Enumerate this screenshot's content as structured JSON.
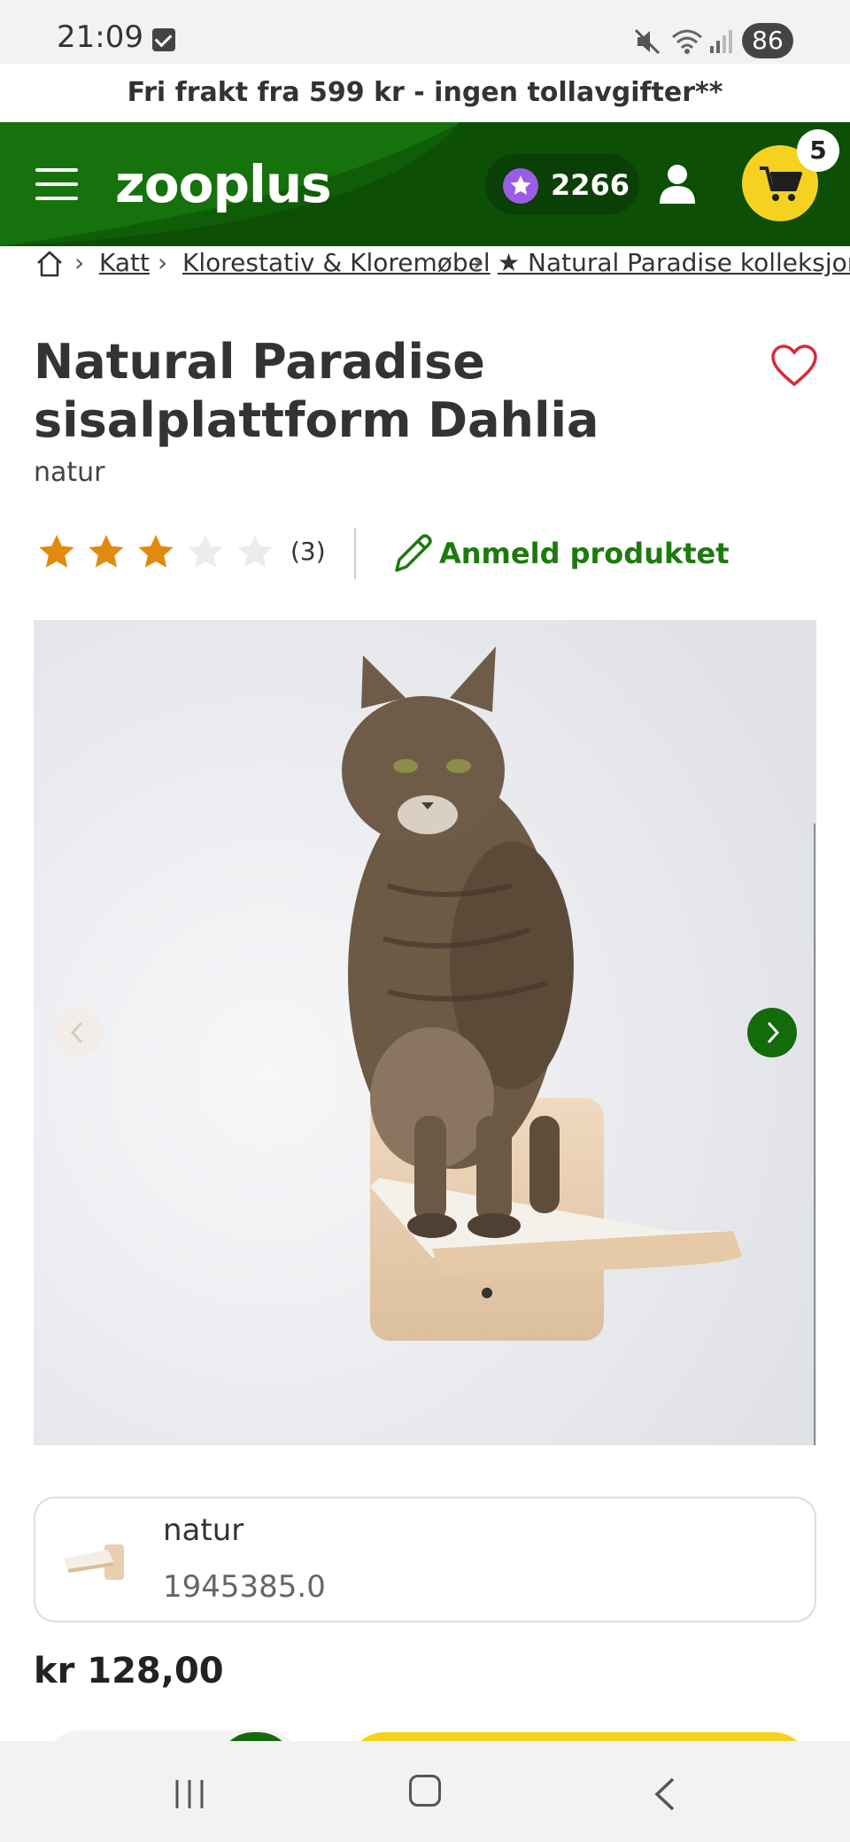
{
  "status_bar": {
    "time": "21:09",
    "battery": "86",
    "icons": [
      "check-icon",
      "mute-icon",
      "wifi-icon",
      "signal-icon"
    ]
  },
  "shipping_banner": "Fri frakt fra 599 kr - ingen tollavgifter**",
  "header": {
    "logo": "zooplus",
    "points": "2266",
    "cart_count": "5",
    "colors": {
      "header_bg": "#0f5e07",
      "cart_bg": "#f5d21f",
      "points_icon": "#9b5de5"
    }
  },
  "breadcrumb": {
    "items": [
      "Katt",
      "Klorestativ & Kloremøbel",
      "★ Natural Paradise kolleksjon"
    ]
  },
  "product": {
    "title": "Natural Paradise sisalplattform Dahlia",
    "color_label": "natur",
    "rating": 3,
    "rating_max": 5,
    "review_count": "(3)",
    "review_link": "Anmeld produktet",
    "price": "kr 128,00"
  },
  "variant": {
    "name": "natur",
    "id": "1945385.0"
  },
  "accent_colors": {
    "green": "#1e7a0f",
    "star": "#e08a0e",
    "star_empty": "#e6e6e6"
  }
}
